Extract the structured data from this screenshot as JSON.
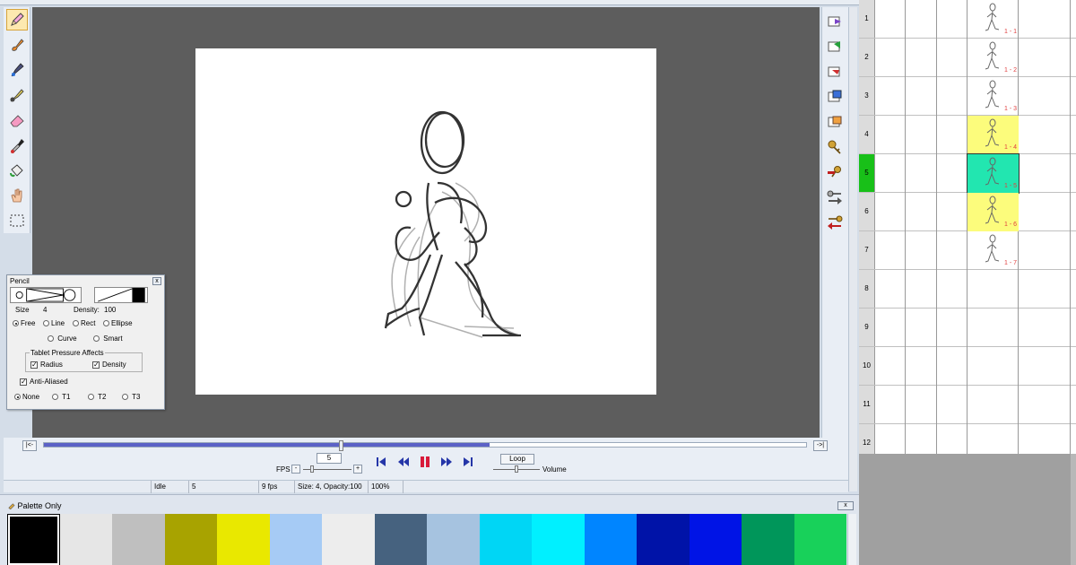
{
  "left_tools": [
    "pencil-icon",
    "brush-icon",
    "ink-pen-icon",
    "airbrush-icon",
    "eraser-icon",
    "dropper-icon",
    "fill-icon",
    "hand-icon",
    "select-icon"
  ],
  "right_tools": [
    "next-frame-icon",
    "insert-frame-icon",
    "flip-frame-icon",
    "copy-frame-icon",
    "paste-frame-icon",
    "keys-icon",
    "key-remove-icon",
    "key-right-icon",
    "key-left-icon"
  ],
  "pencil_panel": {
    "title": "Pencil",
    "close": "x",
    "size_label": "Size",
    "size_value": "4",
    "density_label": "Density:",
    "density_value": "100",
    "mode_free": "Free",
    "mode_line": "Line",
    "mode_rect": "Rect",
    "mode_ellipse": "Ellipse",
    "mode_curve": "Curve",
    "mode_smart": "Smart",
    "pressure_group": "Tablet Pressure Affects",
    "pressure_radius": "Radius",
    "pressure_density": "Density",
    "anti_aliased": "Anti-Aliased",
    "t_none": "None",
    "t1": "T1",
    "t2": "T2",
    "t3": "T3"
  },
  "playback": {
    "start_btn": "|<-",
    "end_btn": "->|",
    "frame_value": "5",
    "fps_label": "FPS",
    "minus": "-",
    "plus": "+",
    "loop_label": "Loop",
    "volume_label": "Volume",
    "progress": 0.39
  },
  "status": {
    "state": "Idle",
    "frame": "5",
    "fps": "9 fps",
    "brush": "Size: 4, Opacity:100",
    "zoom": "100%"
  },
  "palette": {
    "title": "Palette Only",
    "close": "x",
    "colors": [
      "#000000",
      "#e6e6e6",
      "#bfbfbf",
      "#a8a300",
      "#e9e800",
      "#a6cbf5",
      "#ededed",
      "#46627f",
      "#a6c3e0",
      "#00d6f5",
      "#00f0ff",
      "#0085ff",
      "#0013a8",
      "#0014e6",
      "#00965a",
      "#18d15a"
    ]
  },
  "xsheet": {
    "rows": [
      {
        "n": "1",
        "label": "1 - 1",
        "hl": "",
        "fig": true
      },
      {
        "n": "2",
        "label": "1 - 2",
        "hl": "",
        "fig": true
      },
      {
        "n": "3",
        "label": "1 - 3",
        "hl": "",
        "fig": true
      },
      {
        "n": "4",
        "label": "1 - 4",
        "hl": "#fcfc7c",
        "fig": true
      },
      {
        "n": "5",
        "label": "1 - 5",
        "hl": "#22e6b0",
        "fig": true,
        "current": true
      },
      {
        "n": "6",
        "label": "1 - 6",
        "hl": "#fcfc7c",
        "fig": true
      },
      {
        "n": "7",
        "label": "1 - 7",
        "hl": "",
        "fig": true
      },
      {
        "n": "8",
        "label": "",
        "hl": "",
        "fig": false
      },
      {
        "n": "9",
        "label": "",
        "hl": "",
        "fig": false
      },
      {
        "n": "10",
        "label": "",
        "hl": "",
        "fig": false
      },
      {
        "n": "11",
        "label": "",
        "hl": "",
        "fig": false
      },
      {
        "n": "12",
        "label": "",
        "hl": "",
        "fig": false
      }
    ]
  },
  "colors": {
    "canvas_bg": "#5d5d5d",
    "timeline": "#5b61c6",
    "current_frame": "#18c018"
  }
}
